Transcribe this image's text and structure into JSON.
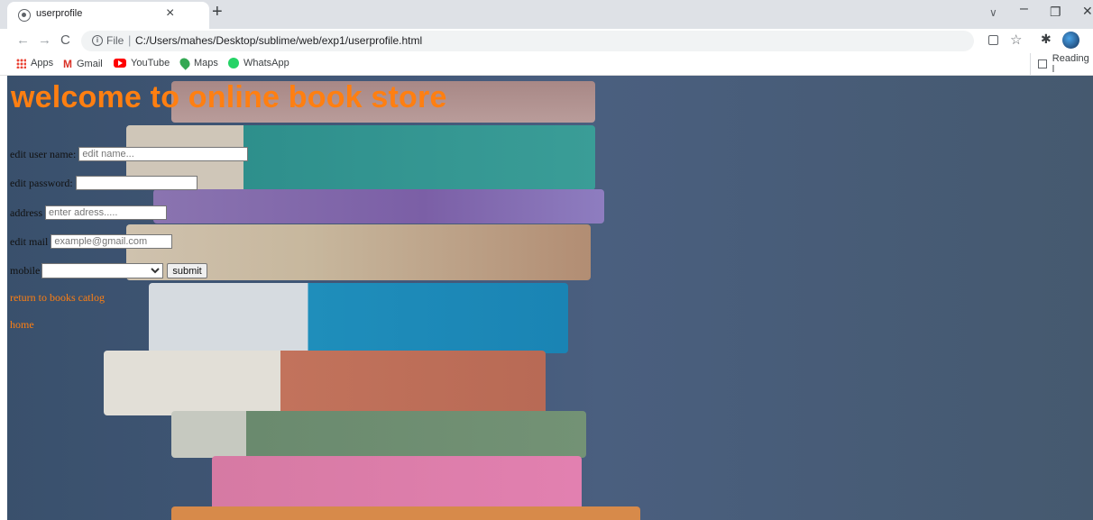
{
  "browser": {
    "tab_title": "userprofile",
    "tab_close": "×",
    "new_tab": "+",
    "tabs_menu": "∨",
    "window_minimize": "–",
    "window_restore": "❐",
    "window_close": "✕",
    "nav_back": "←",
    "nav_forward": "→",
    "nav_reload": "C",
    "file_label": "File",
    "url": "C:/Users/mahes/Desktop/sublime/web/exp1/userprofile.html",
    "star": "☆",
    "extensions": "✱",
    "bookmarks": [
      {
        "label": "Apps",
        "icon": "apps-grid-icon"
      },
      {
        "label": "Gmail",
        "icon": "gmail-icon"
      },
      {
        "label": "YouTube",
        "icon": "youtube-icon"
      },
      {
        "label": "Maps",
        "icon": "maps-icon"
      },
      {
        "label": "WhatsApp",
        "icon": "whatsapp-icon"
      }
    ],
    "reading_list": "Reading l"
  },
  "page": {
    "title": "welcome to online book store",
    "title_color": "#ff7f11",
    "form": {
      "username_label": "edit user name:",
      "username_placeholder": "edit name...",
      "password_label": "edit password:",
      "address_label": "address",
      "address_placeholder": "enter adress.....",
      "mail_label": "edit mail",
      "mail_placeholder": "example@gmail.com",
      "mobile_label": "mobile",
      "submit_label": "submit"
    },
    "links": {
      "catalog": "return to books catlog",
      "home": "home"
    }
  }
}
